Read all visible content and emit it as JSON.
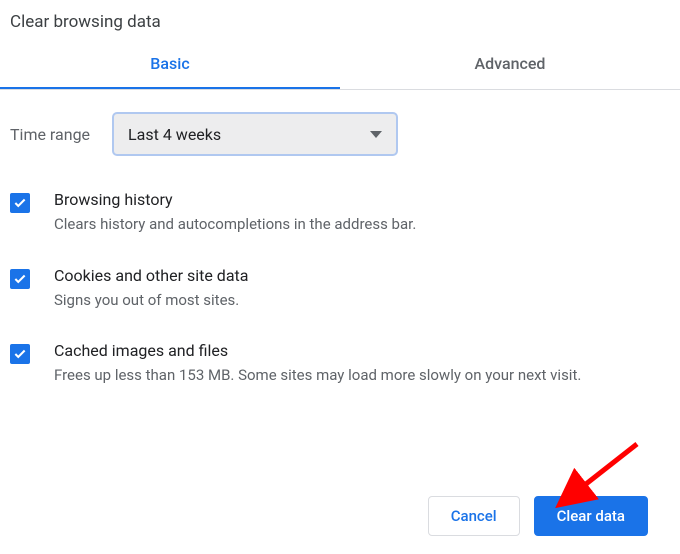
{
  "title": "Clear browsing data",
  "tabs": {
    "basic": "Basic",
    "advanced": "Advanced"
  },
  "time_range": {
    "label": "Time range",
    "value": "Last 4 weeks"
  },
  "options": [
    {
      "title": "Browsing history",
      "desc": "Clears history and autocompletions in the address bar."
    },
    {
      "title": "Cookies and other site data",
      "desc": "Signs you out of most sites."
    },
    {
      "title": "Cached images and files",
      "desc": "Frees up less than 153 MB. Some sites may load more slowly on your next visit."
    }
  ],
  "buttons": {
    "cancel": "Cancel",
    "clear": "Clear data"
  },
  "colors": {
    "accent": "#1a73e8",
    "muted": "#5f6368"
  }
}
